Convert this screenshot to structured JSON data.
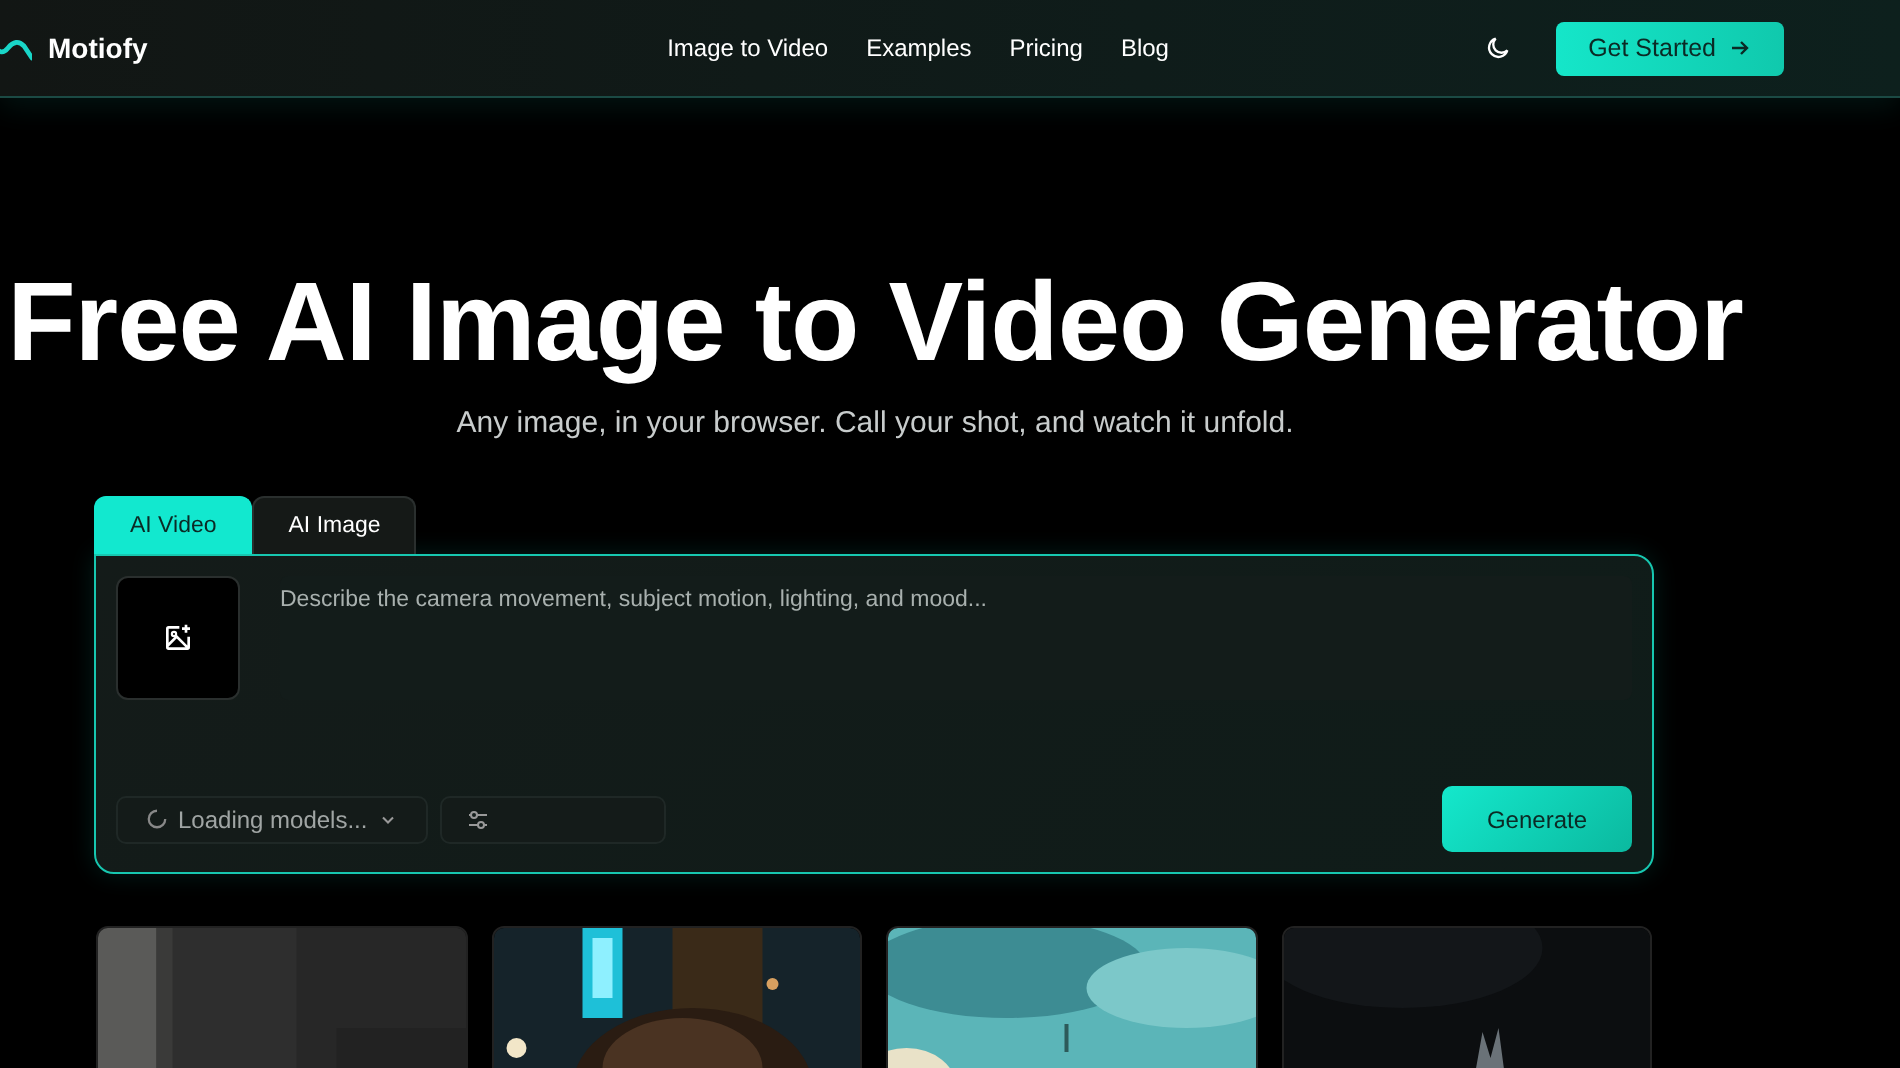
{
  "header": {
    "logo": "Motiofy",
    "nav": [
      "Image to Video",
      "Examples",
      "Pricing",
      "Blog"
    ],
    "cta": "Get Started"
  },
  "hero": {
    "title": "Free AI Image to Video Generator",
    "subtitle": "Any image, in your browser. Call your shot, and watch it unfold."
  },
  "tabs": [
    {
      "label": "AI Video",
      "selected": true
    },
    {
      "label": "AI Image",
      "selected": false
    }
  ],
  "prompt": {
    "placeholder": "Describe the camera movement, subject motion, lighting, and mood..."
  },
  "model_select": {
    "value": "Loading models..."
  },
  "generate_button": "Generate"
}
